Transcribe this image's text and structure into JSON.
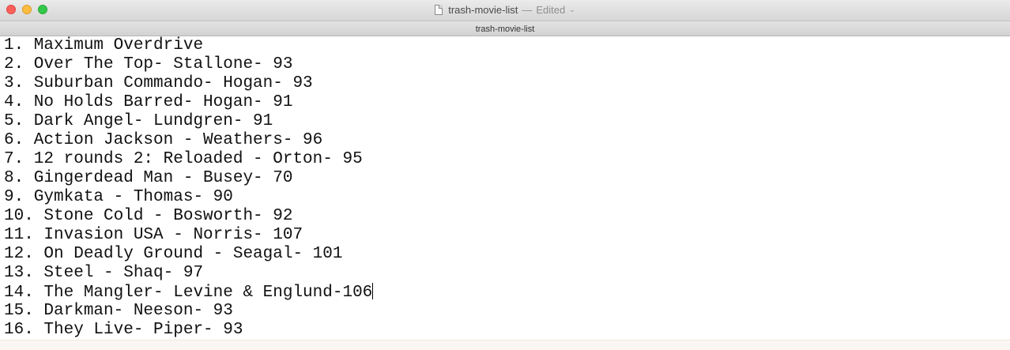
{
  "window": {
    "title": "trash-movie-list",
    "separator": "—",
    "status": "Edited",
    "tab": "trash-movie-list"
  },
  "lines": [
    "1. Maximum Overdrive",
    "2. Over The Top- Stallone- 93",
    "3. Suburban Commando- Hogan- 93",
    "4. No Holds Barred- Hogan- 91",
    "5. Dark Angel- Lundgren- 91",
    "6. Action Jackson - Weathers- 96",
    "7. 12 rounds 2: Reloaded - Orton- 95",
    "8. Gingerdead Man - Busey- 70",
    "9. Gymkata - Thomas- 90",
    "10. Stone Cold - Bosworth- 92",
    "11. Invasion USA - Norris- 107",
    "12. On Deadly Ground - Seagal- 101",
    "13. Steel - Shaq- 97",
    "14. The Mangler- Levine & Englund-106",
    "15. Darkman- Neeson- 93",
    "16. They Live- Piper- 93"
  ],
  "icons": {
    "document": "document-icon",
    "chevron": "chevron-down-icon"
  },
  "colors": {
    "close": "#fc605b",
    "minimize": "#fdbc40",
    "zoom": "#34c84a"
  }
}
